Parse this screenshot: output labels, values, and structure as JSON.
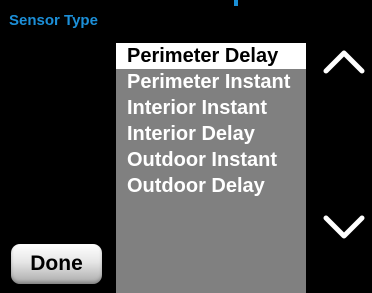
{
  "header": {
    "title": "Sensor Type"
  },
  "sensor_list": {
    "items": [
      {
        "label": "Perimeter Delay",
        "selected": true
      },
      {
        "label": "Perimeter Instant",
        "selected": false
      },
      {
        "label": "Interior Instant",
        "selected": false
      },
      {
        "label": "Interior Delay",
        "selected": false
      },
      {
        "label": "Outdoor Instant",
        "selected": false
      },
      {
        "label": "Outdoor Delay",
        "selected": false
      }
    ]
  },
  "controls": {
    "scroll_up_icon": "chevron-up-icon",
    "scroll_down_icon": "chevron-down-icon",
    "done_label": "Done"
  },
  "colors": {
    "background": "#000000",
    "title": "#1c8fd8",
    "list_background": "#808080",
    "selected_background": "#ffffff",
    "selected_text": "#000000",
    "item_text": "#ffffff"
  }
}
